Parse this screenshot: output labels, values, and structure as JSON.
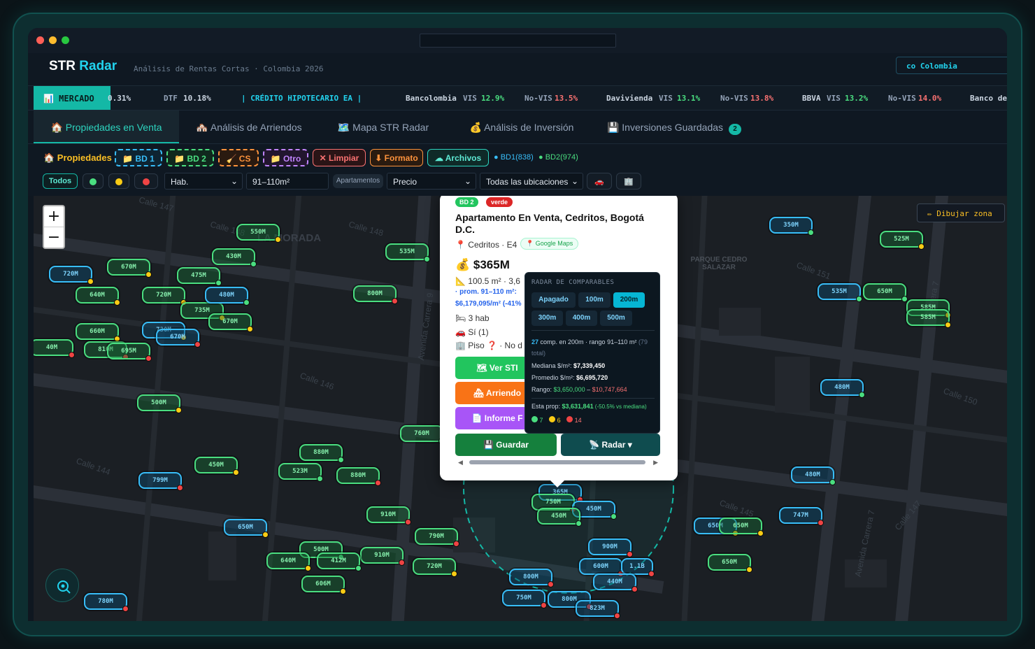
{
  "app": {
    "brand_plain": "STR",
    "brand_accent": "Radar",
    "subtitle": "Análisis de Rentas Cortas · Colombia 2026",
    "country": "co Colombia"
  },
  "ticker": {
    "market": "MERCADO",
    "first_value": "0.31%",
    "dtf_label": "DTF",
    "dtf_value": "10.18%",
    "credit_label": "| CRÉDITO HIPOTECARIO EA |",
    "banks": [
      {
        "name": "Bancolombia",
        "vis_label": "VIS",
        "vis": "12.9%",
        "novis_label": "No-VIS",
        "novis": "13.5%"
      },
      {
        "name": "Davivienda",
        "vis_label": "VIS",
        "vis": "13.1%",
        "novis_label": "No-VIS",
        "novis": "13.8%"
      },
      {
        "name": "BBVA",
        "vis_label": "VIS",
        "vis": "13.2%",
        "novis_label": "No-VIS",
        "novis": "14.0%"
      }
    ],
    "tail": "Banco de"
  },
  "tabs": [
    {
      "label": "🏠 Propiedades en Venta"
    },
    {
      "label": "🏘️ Análisis de Arriendos"
    },
    {
      "label": "🗺️ Mapa STR Radar"
    },
    {
      "label": "💰 Análisis de Inversión"
    },
    {
      "label": "💾 Inversiones Guardadas",
      "badge": "2"
    }
  ],
  "toolbar": {
    "title": "🏠 Propiedades",
    "chips": [
      {
        "label": "📁 BD 1",
        "color": "#38bdf8"
      },
      {
        "label": "📁 BD 2",
        "color": "#4ade80"
      },
      {
        "label": "🧹 CS",
        "color": "#fb923c"
      },
      {
        "label": "📁 Otro",
        "color": "#c084fc"
      },
      {
        "label": "✕ Limpiar",
        "color": "#f87171"
      },
      {
        "label": "⬇ Formato",
        "color": "#fb923c"
      },
      {
        "label": "☁ Archivos",
        "color": "#5eead4"
      }
    ],
    "counts": [
      "● BD1(838)",
      "● BD2(974)"
    ],
    "todos": "Todos",
    "filters": {
      "hab": "Hab.",
      "area": "91–110m²",
      "type": "Apartamentos",
      "price": "Precio",
      "location": "Todas las ubicaciones"
    }
  },
  "map": {
    "draw_zone": "✏ Dibujar zona",
    "zoom_in": "+",
    "zoom_out": "−",
    "place_labels": [
      "LA MORADA",
      "PARQUE CEDRO SALAZAR"
    ],
    "streets": [
      "Calle 147",
      "Calle 148",
      "Calle 146",
      "Calle 144",
      "Calle 145",
      "Calle 150",
      "Calle 151",
      "Avenida Carrera 9",
      "Avenida Carrera 7",
      "Carrera 7",
      "Calle 147"
    ],
    "pins": [
      {
        "label": "550M",
        "s": "g",
        "d": "y"
      },
      {
        "label": "430M",
        "s": "g",
        "d": "g"
      },
      {
        "label": "670M",
        "s": "g",
        "d": "y"
      },
      {
        "label": "720M",
        "s": "b",
        "d": "y"
      },
      {
        "label": "640M",
        "s": "g",
        "d": "y"
      },
      {
        "label": "475M",
        "s": "g",
        "d": "g"
      },
      {
        "label": "720M",
        "s": "g",
        "d": "y"
      },
      {
        "label": "735M",
        "s": "g",
        "d": "y"
      },
      {
        "label": "480M",
        "s": "b",
        "d": "g"
      },
      {
        "label": "670M",
        "s": "g",
        "d": "y"
      },
      {
        "label": "660M",
        "s": "g",
        "d": "y"
      },
      {
        "label": "730M",
        "s": "b",
        "d": "y"
      },
      {
        "label": "670M",
        "s": "b",
        "d": "r"
      },
      {
        "label": "810M",
        "s": "g",
        "d": "r"
      },
      {
        "label": "695M",
        "s": "g",
        "d": "r"
      },
      {
        "label": "40M",
        "s": "g",
        "d": "r"
      },
      {
        "label": "535M",
        "s": "g",
        "d": "g"
      },
      {
        "label": "800M",
        "s": "g",
        "d": "r"
      },
      {
        "label": "500M",
        "s": "g",
        "d": "y"
      },
      {
        "label": "760M",
        "s": "g",
        "d": "g"
      },
      {
        "label": "880M",
        "s": "g",
        "d": "g"
      },
      {
        "label": "523M",
        "s": "g",
        "d": "g"
      },
      {
        "label": "880M",
        "s": "g",
        "d": "r"
      },
      {
        "label": "799M",
        "s": "b",
        "d": "r"
      },
      {
        "label": "450M",
        "s": "g",
        "d": "y"
      },
      {
        "label": "650M",
        "s": "b",
        "d": "y"
      },
      {
        "label": "910M",
        "s": "g",
        "d": "r"
      },
      {
        "label": "910M",
        "s": "g",
        "d": "r"
      },
      {
        "label": "500M",
        "s": "g",
        "d": "g"
      },
      {
        "label": "640M",
        "s": "g",
        "d": "y"
      },
      {
        "label": "412M",
        "s": "g",
        "d": "g"
      },
      {
        "label": "606M",
        "s": "g",
        "d": "y"
      },
      {
        "label": "790M",
        "s": "g",
        "d": "r"
      },
      {
        "label": "720M",
        "s": "g",
        "d": "y"
      },
      {
        "label": "780M",
        "s": "b",
        "d": "r"
      },
      {
        "label": "365M",
        "s": "b",
        "d": "r"
      },
      {
        "label": "750M",
        "s": "g",
        "d": "r"
      },
      {
        "label": "450M",
        "s": "b",
        "d": "g"
      },
      {
        "label": "450M",
        "s": "g",
        "d": "g"
      },
      {
        "label": "900M",
        "s": "b",
        "d": "r"
      },
      {
        "label": "600M",
        "s": "b",
        "d": "r"
      },
      {
        "label": "1.1B",
        "s": "b",
        "d": "r"
      },
      {
        "label": "440M",
        "s": "b",
        "d": "r"
      },
      {
        "label": "800M",
        "s": "b",
        "d": "r"
      },
      {
        "label": "750M",
        "s": "b",
        "d": "r"
      },
      {
        "label": "800M",
        "s": "b",
        "d": "r"
      },
      {
        "label": "823M",
        "s": "b",
        "d": "r"
      },
      {
        "label": "350M",
        "s": "b",
        "d": "g"
      },
      {
        "label": "525M",
        "s": "g",
        "d": "y"
      },
      {
        "label": "535M",
        "s": "b",
        "d": "g"
      },
      {
        "label": "650M",
        "s": "g",
        "d": "g"
      },
      {
        "label": "585M",
        "s": "g",
        "d": "y"
      },
      {
        "label": "585M",
        "s": "g",
        "d": "y"
      },
      {
        "label": "480M",
        "s": "b",
        "d": "g"
      },
      {
        "label": "480M",
        "s": "b",
        "d": "g"
      },
      {
        "label": "747M",
        "s": "b",
        "d": "r"
      },
      {
        "label": "650M",
        "s": "b",
        "d": "y"
      },
      {
        "label": "650M",
        "s": "g",
        "d": "y"
      },
      {
        "label": "650M",
        "s": "g",
        "d": "y"
      }
    ]
  },
  "popup": {
    "badge_db": "BD 2",
    "badge_status": "verde",
    "title": "Apartamento En Venta, Cedritos, Bogotá D.C.",
    "location": "📍 Cedritos · E4",
    "maps_link": "📍 Google Maps",
    "price": "💰 $365M",
    "area": "📐 100.5 m² · 3,6",
    "prom": "· prom. 91–110 m²:",
    "prom_val": "$6,179,095/m² (-41%",
    "hab": "🛏 3 hab",
    "parking": "🚗 Sí (1)",
    "floor": "🏢 Piso ❓ · No d",
    "btn_str": "🗺 Ver STI",
    "btn_arriendo": "🏘 Arriendo",
    "btn_informe": "📄 Informe F",
    "btn_guardar": "💾 Guardar",
    "btn_radar": "📡 Radar ▾"
  },
  "radar": {
    "title": "RADAR DE COMPARABLES",
    "options": [
      "Apagado",
      "100m",
      "200m",
      "300m",
      "400m",
      "500m"
    ],
    "selected": "200m",
    "count": "27",
    "count_text": " comp. en 200m · rango 91–110 m²",
    "total": " (79 total)",
    "median_label": "Mediana $/m²: ",
    "median": "$7,339,450",
    "avg_label": "Promedio $/m²: ",
    "avg": "$6,695,720",
    "range_label": "Rango: ",
    "range_min": "$3,650,000",
    "range_sep": " – ",
    "range_max": "$10,747,664",
    "prop_label": "Esta prop: ",
    "prop": "$3,631,841",
    "prop_delta": " (-50.5% vs mediana)",
    "dots": {
      "green": "7",
      "yellow": "6",
      "red": "14"
    }
  }
}
